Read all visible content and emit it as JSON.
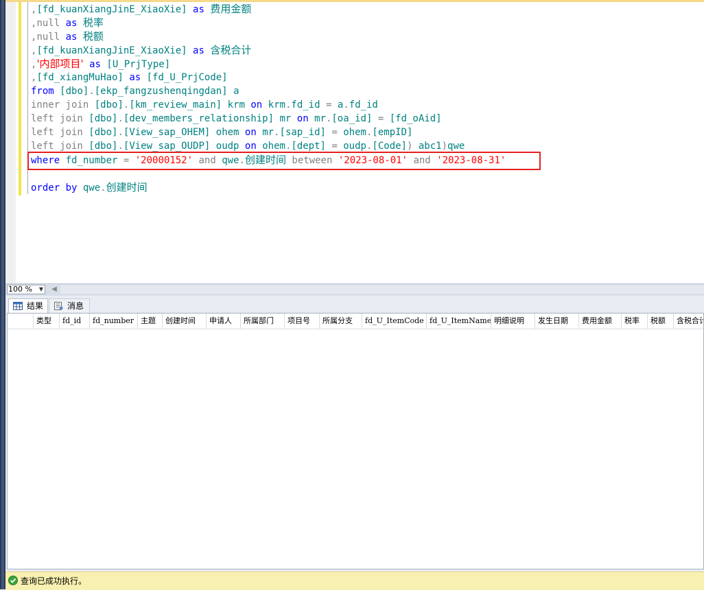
{
  "editor": {
    "lines": [
      [
        [
          ",",
          "op"
        ],
        [
          "[fd_kuanXiangJinE_XiaoXie]",
          "id"
        ],
        [
          " ",
          "plain"
        ],
        [
          "as",
          "kw"
        ],
        [
          " ",
          "plain"
        ],
        [
          "费用金额",
          "id"
        ]
      ],
      [
        [
          ",",
          "op"
        ],
        [
          "null",
          "op"
        ],
        [
          " ",
          "plain"
        ],
        [
          "as",
          "kw"
        ],
        [
          " ",
          "plain"
        ],
        [
          "税率",
          "id"
        ]
      ],
      [
        [
          ",",
          "op"
        ],
        [
          "null",
          "op"
        ],
        [
          " ",
          "plain"
        ],
        [
          "as",
          "kw"
        ],
        [
          " ",
          "plain"
        ],
        [
          "税额",
          "id"
        ]
      ],
      [
        [
          ",",
          "op"
        ],
        [
          "[fd_kuanXiangJinE_XiaoXie]",
          "id"
        ],
        [
          " ",
          "plain"
        ],
        [
          "as",
          "kw"
        ],
        [
          " ",
          "plain"
        ],
        [
          "含税合计",
          "id"
        ]
      ],
      [
        [
          ",",
          "op"
        ],
        [
          "'内部项目'",
          "str"
        ],
        [
          " ",
          "plain"
        ],
        [
          "as",
          "kw"
        ],
        [
          " ",
          "plain"
        ],
        [
          "[U_PrjType]",
          "id"
        ]
      ],
      [
        [
          ",",
          "op"
        ],
        [
          "[fd_xiangMuHao]",
          "id"
        ],
        [
          " ",
          "plain"
        ],
        [
          "as",
          "kw"
        ],
        [
          " ",
          "plain"
        ],
        [
          "[fd_U_PrjCode]",
          "id"
        ]
      ],
      [
        [
          "from",
          "kw"
        ],
        [
          " ",
          "plain"
        ],
        [
          "[dbo]",
          "id"
        ],
        [
          ".",
          "op"
        ],
        [
          "[ekp_fangzushenqingdan]",
          "id"
        ],
        [
          " ",
          "plain"
        ],
        [
          "a",
          "id"
        ]
      ],
      [
        [
          "inner join",
          "op"
        ],
        [
          " ",
          "plain"
        ],
        [
          "[dbo]",
          "id"
        ],
        [
          ".",
          "op"
        ],
        [
          "[km_review_main]",
          "id"
        ],
        [
          " ",
          "plain"
        ],
        [
          "krm",
          "id"
        ],
        [
          " ",
          "plain"
        ],
        [
          "on",
          "kw"
        ],
        [
          " ",
          "plain"
        ],
        [
          "krm",
          "id"
        ],
        [
          ".",
          "op"
        ],
        [
          "fd_id",
          "id"
        ],
        [
          " = ",
          "op"
        ],
        [
          "a",
          "id"
        ],
        [
          ".",
          "op"
        ],
        [
          "fd_id",
          "id"
        ]
      ],
      [
        [
          "left join",
          "op"
        ],
        [
          " ",
          "plain"
        ],
        [
          "[dbo]",
          "id"
        ],
        [
          ".",
          "op"
        ],
        [
          "[dev_members_relationship]",
          "id"
        ],
        [
          " ",
          "plain"
        ],
        [
          "mr",
          "id"
        ],
        [
          " ",
          "plain"
        ],
        [
          "on",
          "kw"
        ],
        [
          " ",
          "plain"
        ],
        [
          "mr",
          "id"
        ],
        [
          ".",
          "op"
        ],
        [
          "[oa_id]",
          "id"
        ],
        [
          " = ",
          "op"
        ],
        [
          "[fd_oAid]",
          "id"
        ]
      ],
      [
        [
          "left join",
          "op"
        ],
        [
          " ",
          "plain"
        ],
        [
          "[dbo]",
          "id"
        ],
        [
          ".",
          "op"
        ],
        [
          "[View_sap_OHEM]",
          "id"
        ],
        [
          " ",
          "plain"
        ],
        [
          "ohem",
          "id"
        ],
        [
          " ",
          "plain"
        ],
        [
          "on",
          "kw"
        ],
        [
          " ",
          "plain"
        ],
        [
          "mr",
          "id"
        ],
        [
          ".",
          "op"
        ],
        [
          "[sap_id]",
          "id"
        ],
        [
          " = ",
          "op"
        ],
        [
          "ohem",
          "id"
        ],
        [
          ".",
          "op"
        ],
        [
          "[empID]",
          "id"
        ]
      ],
      [
        [
          "left join",
          "op"
        ],
        [
          " ",
          "plain"
        ],
        [
          "[dbo]",
          "id"
        ],
        [
          ".",
          "op"
        ],
        [
          "[View_sap_OUDP]",
          "id"
        ],
        [
          " ",
          "plain"
        ],
        [
          "oudp",
          "id"
        ],
        [
          " ",
          "plain"
        ],
        [
          "on",
          "kw"
        ],
        [
          " ",
          "plain"
        ],
        [
          "ohem",
          "id"
        ],
        [
          ".",
          "op"
        ],
        [
          "[dept]",
          "id"
        ],
        [
          " = ",
          "op"
        ],
        [
          "oudp",
          "id"
        ],
        [
          ".",
          "op"
        ],
        [
          "[Code]",
          "id"
        ],
        [
          ")",
          "op"
        ],
        [
          " ",
          "plain"
        ],
        [
          "abc1",
          "id"
        ],
        [
          ")",
          "op"
        ],
        [
          "qwe",
          "id"
        ]
      ],
      [
        [
          "where",
          "kw"
        ],
        [
          " ",
          "plain"
        ],
        [
          "fd_number",
          "id"
        ],
        [
          " = ",
          "op"
        ],
        [
          "'20000152'",
          "str"
        ],
        [
          " ",
          "plain"
        ],
        [
          "and",
          "op"
        ],
        [
          " ",
          "plain"
        ],
        [
          "qwe",
          "id"
        ],
        [
          ".",
          "op"
        ],
        [
          "创建时间",
          "id"
        ],
        [
          " ",
          "plain"
        ],
        [
          "between",
          "op"
        ],
        [
          " ",
          "plain"
        ],
        [
          "'2023-08-01'",
          "str"
        ],
        [
          " ",
          "plain"
        ],
        [
          "and",
          "op"
        ],
        [
          " ",
          "plain"
        ],
        [
          "'2023-08-31'",
          "str"
        ]
      ],
      [],
      [
        [
          "order by",
          "kw"
        ],
        [
          " ",
          "plain"
        ],
        [
          "qwe",
          "id"
        ],
        [
          ".",
          "op"
        ],
        [
          "创建时间",
          "id"
        ]
      ]
    ]
  },
  "zoom": {
    "value": "100 %"
  },
  "tabs": {
    "results": "结果",
    "messages": "消息"
  },
  "grid": {
    "columns": [
      {
        "label": "类型",
        "w": 38
      },
      {
        "label": "fd_id",
        "w": 44
      },
      {
        "label": "fd_number",
        "w": 70
      },
      {
        "label": "主题",
        "w": 36
      },
      {
        "label": "创建时间",
        "w": 64
      },
      {
        "label": "申请人",
        "w": 50
      },
      {
        "label": "所属部门",
        "w": 64
      },
      {
        "label": "项目号",
        "w": 51
      },
      {
        "label": "所属分支",
        "w": 62
      },
      {
        "label": "fd_U_ItemCode",
        "w": 94
      },
      {
        "label": "fd_U_ItemName",
        "w": 94
      },
      {
        "label": "明细说明",
        "w": 64
      },
      {
        "label": "发生日期",
        "w": 64
      },
      {
        "label": "费用金额",
        "w": 62
      },
      {
        "label": "税率",
        "w": 38
      },
      {
        "label": "税额",
        "w": 38
      },
      {
        "label": "含税合计",
        "w": 64
      }
    ]
  },
  "status": {
    "text": "查询已成功执行。"
  },
  "colors": {
    "keyword": "#0000ff",
    "identifier": "#008080",
    "string": "#ff0000",
    "operator": "#808080",
    "highlight": "#e32020",
    "status_bg": "#f8f0b0"
  }
}
